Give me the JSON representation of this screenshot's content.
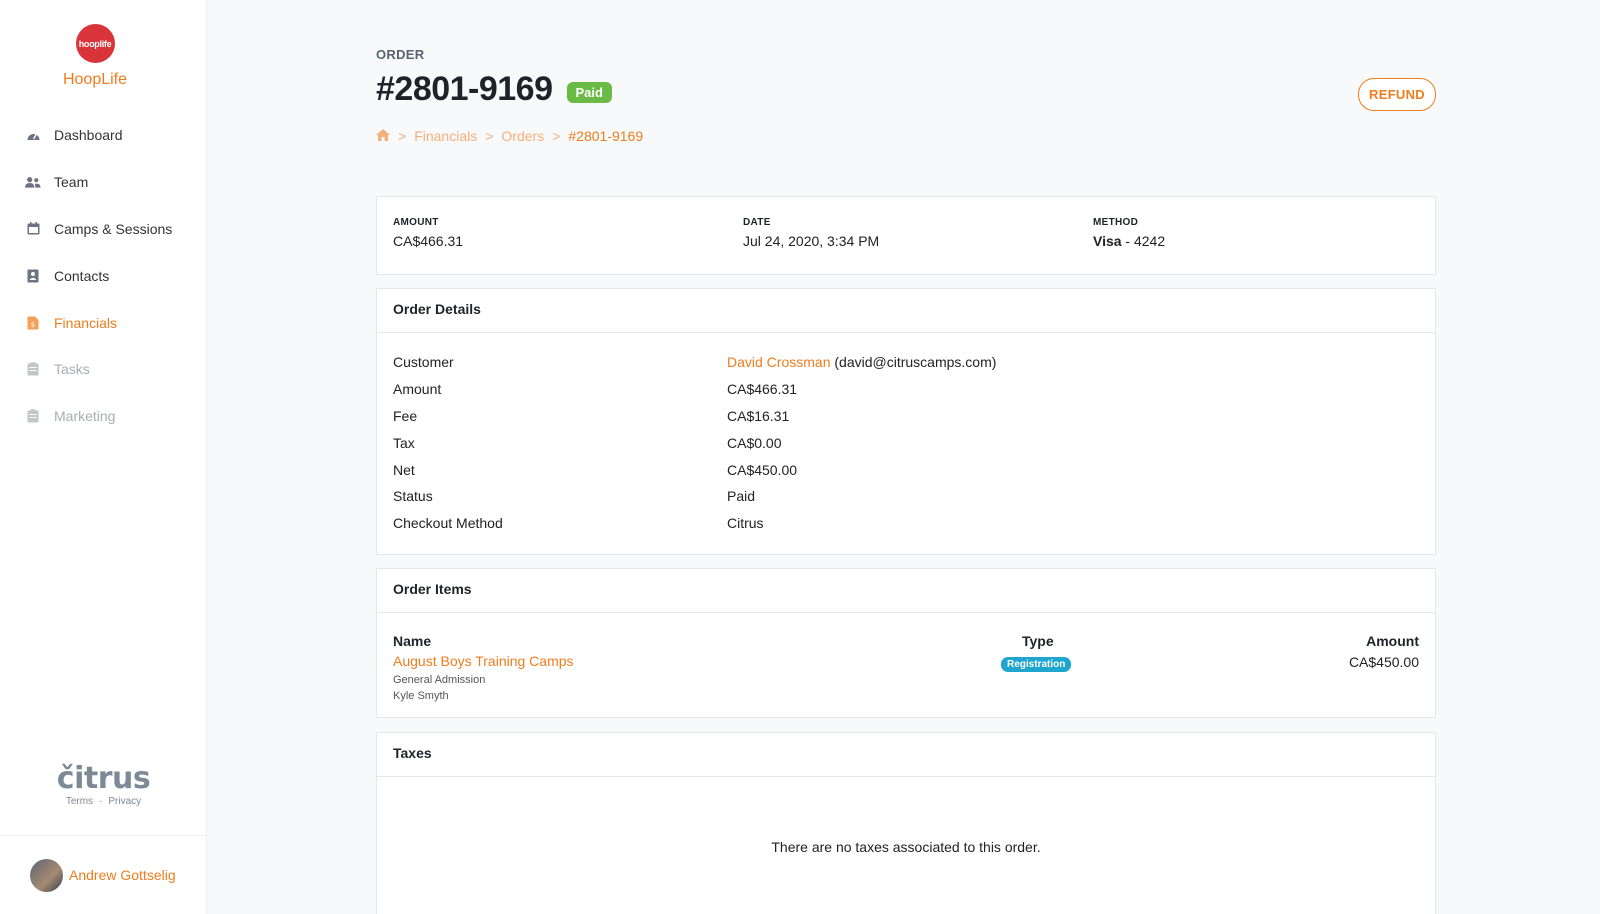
{
  "brand": {
    "logo_text": "hooplife",
    "name": "HoopLife"
  },
  "nav": [
    {
      "label": "Dashboard",
      "icon": "dashboard-icon",
      "state": "normal"
    },
    {
      "label": "Team",
      "icon": "team-icon",
      "state": "normal"
    },
    {
      "label": "Camps & Sessions",
      "icon": "calendar-icon",
      "state": "normal"
    },
    {
      "label": "Contacts",
      "icon": "contacts-icon",
      "state": "normal"
    },
    {
      "label": "Financials",
      "icon": "financials-icon",
      "state": "active"
    },
    {
      "label": "Tasks",
      "icon": "tasks-icon",
      "state": "disabled"
    },
    {
      "label": "Marketing",
      "icon": "marketing-icon",
      "state": "disabled"
    }
  ],
  "footer": {
    "logo": "čitrus",
    "terms": "Terms",
    "dot": "·",
    "privacy": "Privacy"
  },
  "user": {
    "name": "Andrew Gottselig"
  },
  "header": {
    "eyebrow": "ORDER",
    "title": "#2801-9169",
    "status_badge": "Paid",
    "refund_label": "REFUND"
  },
  "breadcrumb": {
    "sep": ">",
    "items": [
      "Financials",
      "Orders"
    ],
    "current": "#2801-9169"
  },
  "summary": {
    "amount_label": "AMOUNT",
    "amount": "CA$466.31",
    "date_label": "DATE",
    "date": "Jul 24, 2020, 3:34 PM",
    "method_label": "METHOD",
    "method_brand": "Visa",
    "method_rest": " - 4242"
  },
  "details": {
    "title": "Order Details",
    "customer_label": "Customer",
    "customer_name": "David Crossman",
    "customer_email": " (david@citruscamps.com)",
    "rows": [
      {
        "label": "Amount",
        "value": "CA$466.31"
      },
      {
        "label": "Fee",
        "value": "CA$16.31"
      },
      {
        "label": "Tax",
        "value": "CA$0.00"
      },
      {
        "label": "Net",
        "value": "CA$450.00"
      },
      {
        "label": "Status",
        "value": "Paid"
      },
      {
        "label": "Checkout Method",
        "value": "Citrus"
      }
    ]
  },
  "items": {
    "title": "Order Items",
    "col_name": "Name",
    "col_type": "Type",
    "col_amount": "Amount",
    "row": {
      "name": "August Boys Training Camps",
      "sub1": "General Admission",
      "sub2": "Kyle Smyth",
      "type": "Registration",
      "amount": "CA$450.00"
    }
  },
  "taxes": {
    "title": "Taxes",
    "empty": "There are no taxes associated to this order."
  },
  "colors": {
    "accent": "#ee7d1e",
    "paid": "#6aba46",
    "registration": "#1fa6cf",
    "brand_red": "#d8343a"
  }
}
